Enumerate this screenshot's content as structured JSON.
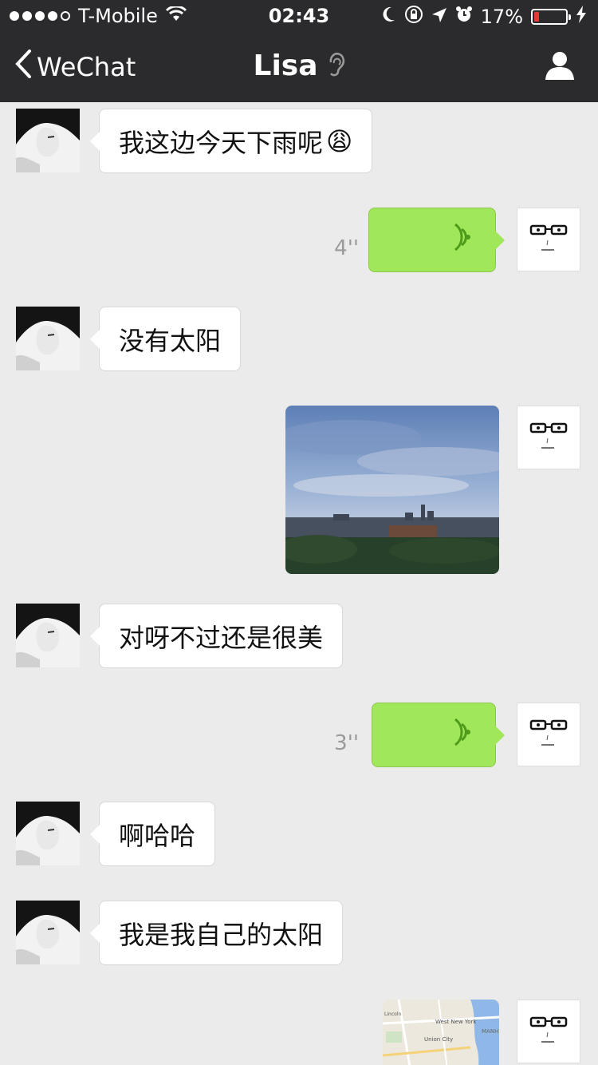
{
  "status_bar": {
    "carrier": "T-Mobile",
    "time": "02:43",
    "battery_percent": "17%",
    "battery_level": 0.17,
    "icons": [
      "signal-dots-icon",
      "wifi-icon",
      "moon-icon",
      "rotation-lock-icon",
      "location-arrow-icon",
      "alarm-icon",
      "battery-icon",
      "charging-bolt-icon"
    ]
  },
  "nav": {
    "back_label": "WeChat",
    "title": "Lisa",
    "icons": [
      "chevron-left-icon",
      "ear-icon",
      "person-icon"
    ]
  },
  "messages": [
    {
      "sender": "Lisa",
      "type": "text",
      "text": "我这边今天下雨呢",
      "emoji": "😩"
    },
    {
      "sender": "me",
      "type": "voice",
      "duration": "4''"
    },
    {
      "sender": "Lisa",
      "type": "text",
      "text": "没有太阳"
    },
    {
      "sender": "me",
      "type": "image",
      "description_icon": "city-skyline-photo"
    },
    {
      "sender": "Lisa",
      "type": "text",
      "text": "对呀不过还是很美"
    },
    {
      "sender": "me",
      "type": "voice",
      "duration": "3''"
    },
    {
      "sender": "Lisa",
      "type": "text",
      "text": "啊哈哈"
    },
    {
      "sender": "Lisa",
      "type": "text",
      "text": "我是我自己的太阳"
    },
    {
      "sender": "me",
      "type": "location"
    }
  ],
  "map_labels": {
    "town1": "West New York",
    "town2": "Union City",
    "town3": "Lincoln",
    "town4": "MANH"
  },
  "colors": {
    "bar": "#2b2b2d",
    "chat_bg": "#ebebeb",
    "out_bubble": "#a0e75a",
    "in_bubble": "#ffffff",
    "voice_wave": "#4e9a1a",
    "battery_low": "#e53935"
  }
}
